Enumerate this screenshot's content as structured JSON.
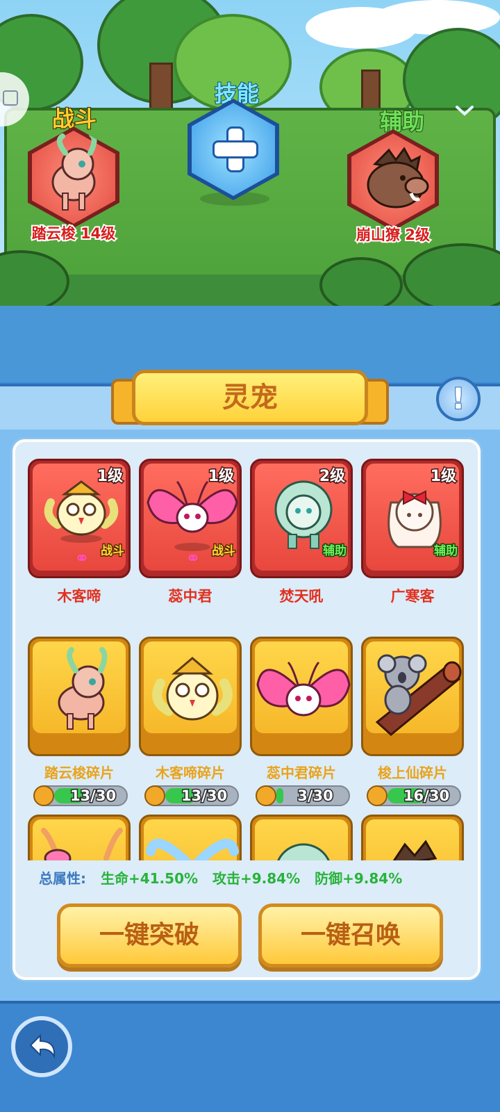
{
  "team": {
    "fight_title": "战斗",
    "skill_title": "技能",
    "assist_title": "辅助",
    "fight_pet_label": "踏云梭 14级",
    "assist_pet_label": "崩山獠 2级"
  },
  "panel": {
    "title": "灵宠"
  },
  "pets": [
    {
      "name": "木客啼",
      "level": "1级",
      "role": "战斗",
      "favorite": true
    },
    {
      "name": "蕊中君",
      "level": "1级",
      "role": "战斗",
      "favorite": true
    },
    {
      "name": "焚天吼",
      "level": "2级",
      "role": "辅助",
      "favorite": false
    },
    {
      "name": "广寒客",
      "level": "1级",
      "role": "辅助",
      "favorite": false
    }
  ],
  "fragments": [
    {
      "name": "踏云梭碎片",
      "progress": "13/30",
      "fraction": 0.433
    },
    {
      "name": "木客啼碎片",
      "progress": "13/30",
      "fraction": 0.433
    },
    {
      "name": "蕊中君碎片",
      "progress": "3/30",
      "fraction": 0.1
    },
    {
      "name": "梭上仙碎片",
      "progress": "16/30",
      "fraction": 0.533
    }
  ],
  "stats": {
    "label": "总属性:",
    "hp": "生命+41.50%",
    "atk": "攻击+9.84%",
    "def": "防御+9.84%"
  },
  "actions": {
    "breakthrough": "一键突破",
    "summon": "一键召唤"
  },
  "colors": {
    "pet_card": "#e8473d",
    "fragment_card": "#f6b82a",
    "progress_fill": "#37c74d",
    "accent_blue": "#3d86d0"
  }
}
